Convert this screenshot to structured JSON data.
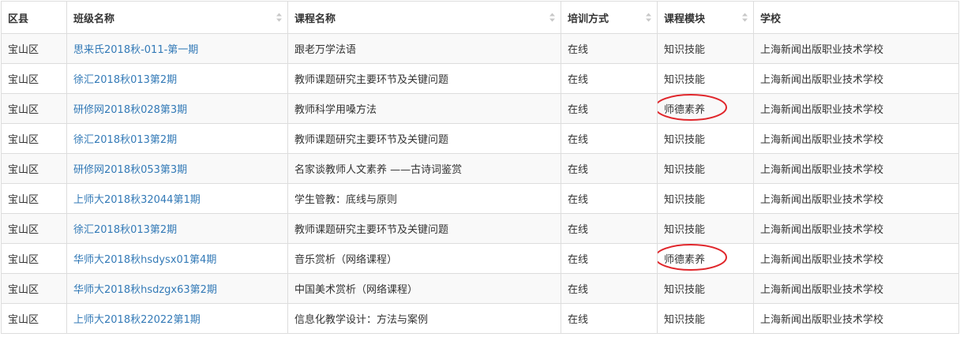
{
  "columns": [
    {
      "label": "区县",
      "sortable": false
    },
    {
      "label": "班级名称",
      "sortable": true
    },
    {
      "label": "课程名称",
      "sortable": true
    },
    {
      "label": "培训方式",
      "sortable": true
    },
    {
      "label": "课程模块",
      "sortable": true
    },
    {
      "label": "学校",
      "sortable": false
    }
  ],
  "rows": [
    {
      "district": "宝山区",
      "class_name": "思来氏2018秋-011-第一期",
      "course": "跟老万学法语",
      "method": "在线",
      "module": "知识技能",
      "school": "上海新闻出版职业技术学校",
      "highlighted": false
    },
    {
      "district": "宝山区",
      "class_name": "徐汇2018秋013第2期",
      "course": "教师课题研究主要环节及关键问题",
      "method": "在线",
      "module": "知识技能",
      "school": "上海新闻出版职业技术学校",
      "highlighted": false
    },
    {
      "district": "宝山区",
      "class_name": "研修网2018秋028第3期",
      "course": "教师科学用嗓方法",
      "method": "在线",
      "module": "师德素养",
      "school": "上海新闻出版职业技术学校",
      "highlighted": true
    },
    {
      "district": "宝山区",
      "class_name": "徐汇2018秋013第2期",
      "course": "教师课题研究主要环节及关键问题",
      "method": "在线",
      "module": "知识技能",
      "school": "上海新闻出版职业技术学校",
      "highlighted": false
    },
    {
      "district": "宝山区",
      "class_name": "研修网2018秋053第3期",
      "course": "名家谈教师人文素养 ——古诗词鉴赏",
      "method": "在线",
      "module": "知识技能",
      "school": "上海新闻出版职业技术学校",
      "highlighted": false
    },
    {
      "district": "宝山区",
      "class_name": "上师大2018秋32044第1期",
      "course": "学生管教：底线与原则",
      "method": "在线",
      "module": "知识技能",
      "school": "上海新闻出版职业技术学校",
      "highlighted": false
    },
    {
      "district": "宝山区",
      "class_name": "徐汇2018秋013第2期",
      "course": "教师课题研究主要环节及关键问题",
      "method": "在线",
      "module": "知识技能",
      "school": "上海新闻出版职业技术学校",
      "highlighted": false
    },
    {
      "district": "宝山区",
      "class_name": "华师大2018秋hsdysx01第4期",
      "course": "音乐赏析（网络课程）",
      "method": "在线",
      "module": "师德素养",
      "school": "上海新闻出版职业技术学校",
      "highlighted": true
    },
    {
      "district": "宝山区",
      "class_name": "华师大2018秋hsdzgx63第2期",
      "course": "中国美术赏析（网络课程）",
      "method": "在线",
      "module": "知识技能",
      "school": "上海新闻出版职业技术学校",
      "highlighted": false
    },
    {
      "district": "宝山区",
      "class_name": "上师大2018秋22022第1期",
      "course": "信息化教学设计：方法与案例",
      "method": "在线",
      "module": "知识技能",
      "school": "上海新闻出版职业技术学校",
      "highlighted": false
    }
  ],
  "colors": {
    "link": "#337ab7",
    "border": "#dddddd",
    "stripe": "#f9f9f9",
    "annotation": "#e0262b"
  },
  "icons": {
    "sort": "sort-both-icon",
    "annotation": "red-circle-annotation"
  }
}
